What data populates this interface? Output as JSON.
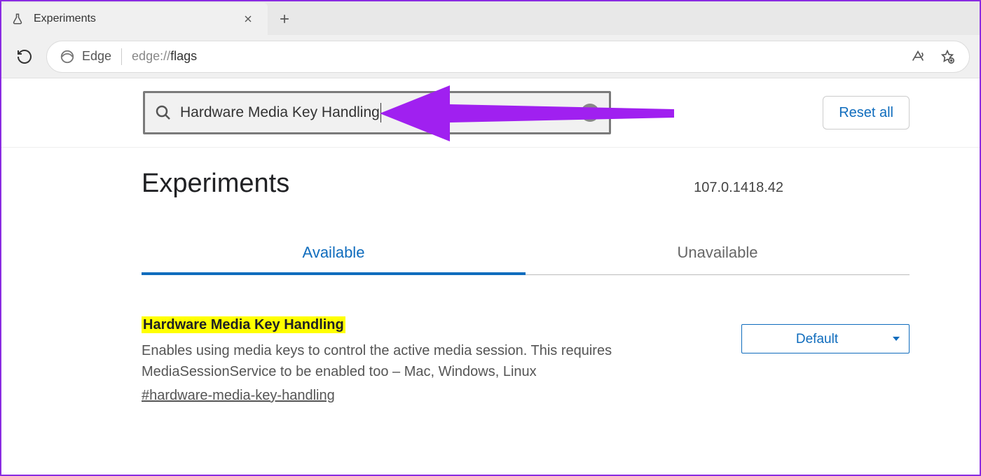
{
  "browser": {
    "tab_title": "Experiments",
    "url_prefix": "edge://",
    "url_path": "flags",
    "edge_label": "Edge"
  },
  "search": {
    "value": "Hardware Media Key Handling",
    "reset_label": "Reset all"
  },
  "header": {
    "title": "Experiments",
    "version": "107.0.1418.42"
  },
  "tabs": {
    "available": "Available",
    "unavailable": "Unavailable"
  },
  "flag": {
    "title": "Hardware Media Key Handling",
    "description": "Enables using media keys to control the active media session. This requires MediaSessionService to be enabled too – Mac, Windows, Linux",
    "id": "#hardware-media-key-handling",
    "select_value": "Default"
  }
}
